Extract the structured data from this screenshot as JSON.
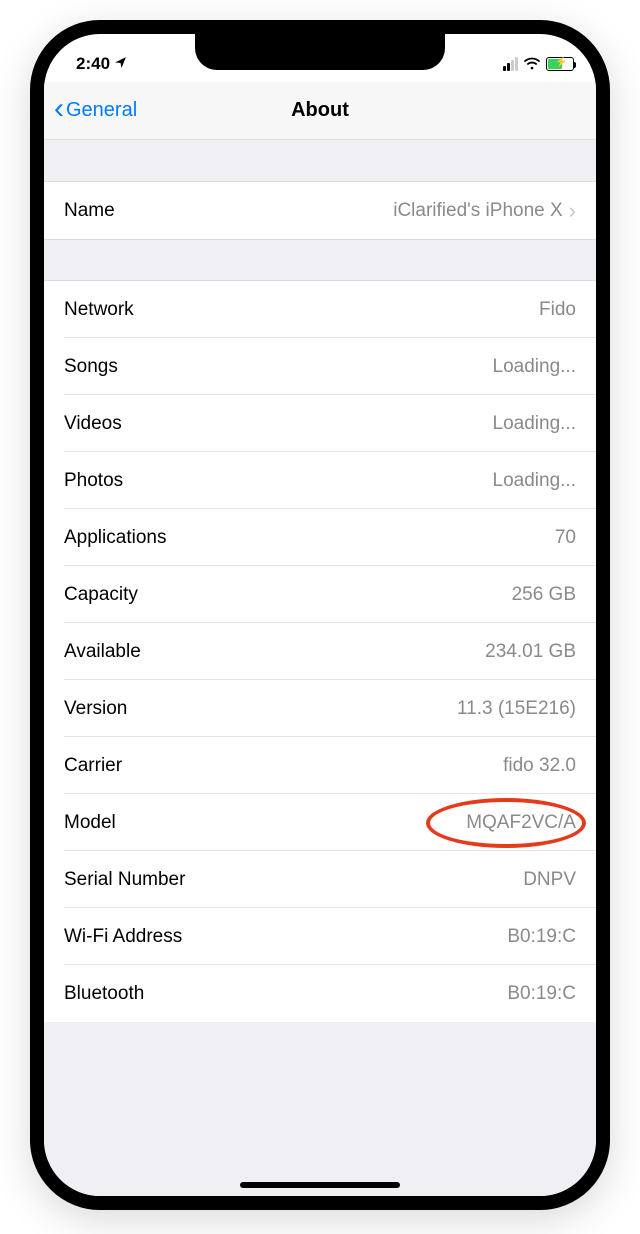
{
  "status": {
    "time": "2:40",
    "location_icon": "location-arrow"
  },
  "nav": {
    "back_label": "General",
    "title": "About"
  },
  "sections": {
    "name": {
      "label": "Name",
      "value": "iClarified's iPhone X"
    },
    "details": [
      {
        "label": "Network",
        "value": "Fido"
      },
      {
        "label": "Songs",
        "value": "Loading..."
      },
      {
        "label": "Videos",
        "value": "Loading..."
      },
      {
        "label": "Photos",
        "value": "Loading..."
      },
      {
        "label": "Applications",
        "value": "70"
      },
      {
        "label": "Capacity",
        "value": "256 GB"
      },
      {
        "label": "Available",
        "value": "234.01 GB"
      },
      {
        "label": "Version",
        "value": "11.3 (15E216)"
      },
      {
        "label": "Carrier",
        "value": "fido 32.0"
      },
      {
        "label": "Model",
        "value": "MQAF2VC/A",
        "highlighted": true
      },
      {
        "label": "Serial Number",
        "value": "DNPV"
      },
      {
        "label": "Wi-Fi Address",
        "value": "B0:19:C"
      },
      {
        "label": "Bluetooth",
        "value": "B0:19:C"
      }
    ]
  }
}
